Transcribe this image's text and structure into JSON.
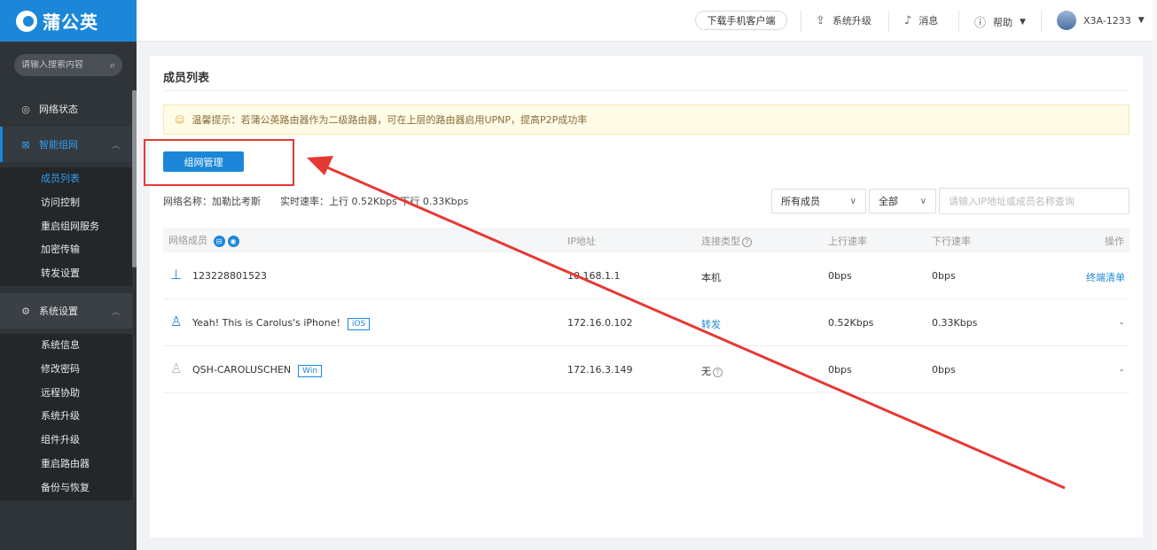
{
  "logo": {
    "text": "蒲公英"
  },
  "sidebar": {
    "search_placeholder": "请输入搜索内容",
    "network_status": "网络状态",
    "smart_network": "智能组网",
    "smart_items": [
      "成员列表",
      "访问控制",
      "重启组网服务",
      "加密传输",
      "转发设置"
    ],
    "system_settings": "系统设置",
    "system_items": [
      "系统信息",
      "修改密码",
      "远程协助",
      "系统升级",
      "组件升级",
      "重启路由器",
      "备份与恢复"
    ]
  },
  "topbar": {
    "download": "下载手机客户端",
    "upgrade": "系统升级",
    "messages": "消息",
    "help": "帮助",
    "device": "X3A-1233"
  },
  "main": {
    "title": "成员列表",
    "tip": "温馨提示：若蒲公英路由器作为二级路由器，可在上层的路由器启用UPNP，提高P2P成功率",
    "manage_button": "组网管理",
    "network_name": "网络名称：加勒比考斯",
    "realtime_speed": "实时速率：上行 0.52Kbps  下行 0.33Kbps",
    "filter_member": "所有成员",
    "filter_all": "全部",
    "search_placeholder": "请输入IP地址或成员名称查询",
    "columns": {
      "member": "网络成员",
      "ip": "IP地址",
      "conn": "连接类型",
      "up": "上行速率",
      "down": "下行速率",
      "op": "操作"
    },
    "rows": [
      {
        "name": "123228801523",
        "tag": "",
        "ip": "10.168.1.1",
        "conn": "本机",
        "up": "0bps",
        "down": "0bps",
        "op": "终端清单"
      },
      {
        "name": "Yeah! This is Carolus's iPhone!",
        "tag": "iOS",
        "ip": "172.16.0.102",
        "conn": "转发",
        "up": "0.52Kbps",
        "down": "0.33Kbps",
        "op": "-"
      },
      {
        "name": "QSH-CAROLUSCHEN",
        "tag": "Win",
        "ip": "172.16.3.149",
        "conn": "无",
        "up": "0bps",
        "down": "0bps",
        "op": "-"
      }
    ]
  },
  "colors": {
    "brand": "#1c87d9",
    "annotation": "#e53935"
  }
}
